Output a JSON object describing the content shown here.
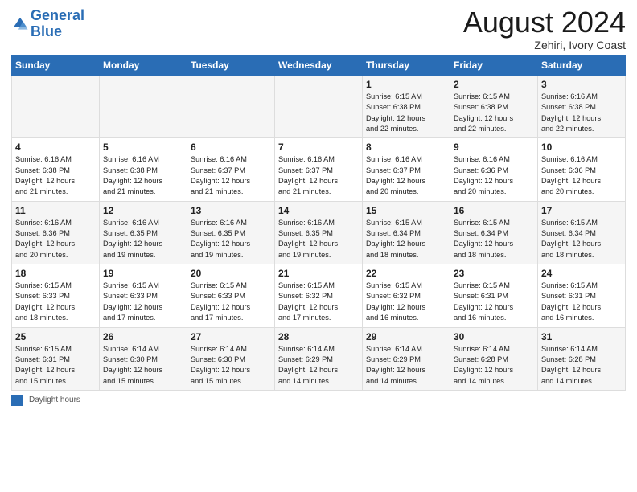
{
  "header": {
    "logo_line1": "General",
    "logo_line2": "Blue",
    "month_year": "August 2024",
    "location": "Zehiri, Ivory Coast"
  },
  "days_of_week": [
    "Sunday",
    "Monday",
    "Tuesday",
    "Wednesday",
    "Thursday",
    "Friday",
    "Saturday"
  ],
  "weeks": [
    [
      {
        "day": "",
        "info": ""
      },
      {
        "day": "",
        "info": ""
      },
      {
        "day": "",
        "info": ""
      },
      {
        "day": "",
        "info": ""
      },
      {
        "day": "1",
        "info": "Sunrise: 6:15 AM\nSunset: 6:38 PM\nDaylight: 12 hours\nand 22 minutes."
      },
      {
        "day": "2",
        "info": "Sunrise: 6:15 AM\nSunset: 6:38 PM\nDaylight: 12 hours\nand 22 minutes."
      },
      {
        "day": "3",
        "info": "Sunrise: 6:16 AM\nSunset: 6:38 PM\nDaylight: 12 hours\nand 22 minutes."
      }
    ],
    [
      {
        "day": "4",
        "info": "Sunrise: 6:16 AM\nSunset: 6:38 PM\nDaylight: 12 hours\nand 21 minutes."
      },
      {
        "day": "5",
        "info": "Sunrise: 6:16 AM\nSunset: 6:38 PM\nDaylight: 12 hours\nand 21 minutes."
      },
      {
        "day": "6",
        "info": "Sunrise: 6:16 AM\nSunset: 6:37 PM\nDaylight: 12 hours\nand 21 minutes."
      },
      {
        "day": "7",
        "info": "Sunrise: 6:16 AM\nSunset: 6:37 PM\nDaylight: 12 hours\nand 21 minutes."
      },
      {
        "day": "8",
        "info": "Sunrise: 6:16 AM\nSunset: 6:37 PM\nDaylight: 12 hours\nand 20 minutes."
      },
      {
        "day": "9",
        "info": "Sunrise: 6:16 AM\nSunset: 6:36 PM\nDaylight: 12 hours\nand 20 minutes."
      },
      {
        "day": "10",
        "info": "Sunrise: 6:16 AM\nSunset: 6:36 PM\nDaylight: 12 hours\nand 20 minutes."
      }
    ],
    [
      {
        "day": "11",
        "info": "Sunrise: 6:16 AM\nSunset: 6:36 PM\nDaylight: 12 hours\nand 20 minutes."
      },
      {
        "day": "12",
        "info": "Sunrise: 6:16 AM\nSunset: 6:35 PM\nDaylight: 12 hours\nand 19 minutes."
      },
      {
        "day": "13",
        "info": "Sunrise: 6:16 AM\nSunset: 6:35 PM\nDaylight: 12 hours\nand 19 minutes."
      },
      {
        "day": "14",
        "info": "Sunrise: 6:16 AM\nSunset: 6:35 PM\nDaylight: 12 hours\nand 19 minutes."
      },
      {
        "day": "15",
        "info": "Sunrise: 6:15 AM\nSunset: 6:34 PM\nDaylight: 12 hours\nand 18 minutes."
      },
      {
        "day": "16",
        "info": "Sunrise: 6:15 AM\nSunset: 6:34 PM\nDaylight: 12 hours\nand 18 minutes."
      },
      {
        "day": "17",
        "info": "Sunrise: 6:15 AM\nSunset: 6:34 PM\nDaylight: 12 hours\nand 18 minutes."
      }
    ],
    [
      {
        "day": "18",
        "info": "Sunrise: 6:15 AM\nSunset: 6:33 PM\nDaylight: 12 hours\nand 18 minutes."
      },
      {
        "day": "19",
        "info": "Sunrise: 6:15 AM\nSunset: 6:33 PM\nDaylight: 12 hours\nand 17 minutes."
      },
      {
        "day": "20",
        "info": "Sunrise: 6:15 AM\nSunset: 6:33 PM\nDaylight: 12 hours\nand 17 minutes."
      },
      {
        "day": "21",
        "info": "Sunrise: 6:15 AM\nSunset: 6:32 PM\nDaylight: 12 hours\nand 17 minutes."
      },
      {
        "day": "22",
        "info": "Sunrise: 6:15 AM\nSunset: 6:32 PM\nDaylight: 12 hours\nand 16 minutes."
      },
      {
        "day": "23",
        "info": "Sunrise: 6:15 AM\nSunset: 6:31 PM\nDaylight: 12 hours\nand 16 minutes."
      },
      {
        "day": "24",
        "info": "Sunrise: 6:15 AM\nSunset: 6:31 PM\nDaylight: 12 hours\nand 16 minutes."
      }
    ],
    [
      {
        "day": "25",
        "info": "Sunrise: 6:15 AM\nSunset: 6:31 PM\nDaylight: 12 hours\nand 15 minutes."
      },
      {
        "day": "26",
        "info": "Sunrise: 6:14 AM\nSunset: 6:30 PM\nDaylight: 12 hours\nand 15 minutes."
      },
      {
        "day": "27",
        "info": "Sunrise: 6:14 AM\nSunset: 6:30 PM\nDaylight: 12 hours\nand 15 minutes."
      },
      {
        "day": "28",
        "info": "Sunrise: 6:14 AM\nSunset: 6:29 PM\nDaylight: 12 hours\nand 14 minutes."
      },
      {
        "day": "29",
        "info": "Sunrise: 6:14 AM\nSunset: 6:29 PM\nDaylight: 12 hours\nand 14 minutes."
      },
      {
        "day": "30",
        "info": "Sunrise: 6:14 AM\nSunset: 6:28 PM\nDaylight: 12 hours\nand 14 minutes."
      },
      {
        "day": "31",
        "info": "Sunrise: 6:14 AM\nSunset: 6:28 PM\nDaylight: 12 hours\nand 14 minutes."
      }
    ]
  ],
  "footer": {
    "label": "Daylight hours"
  }
}
